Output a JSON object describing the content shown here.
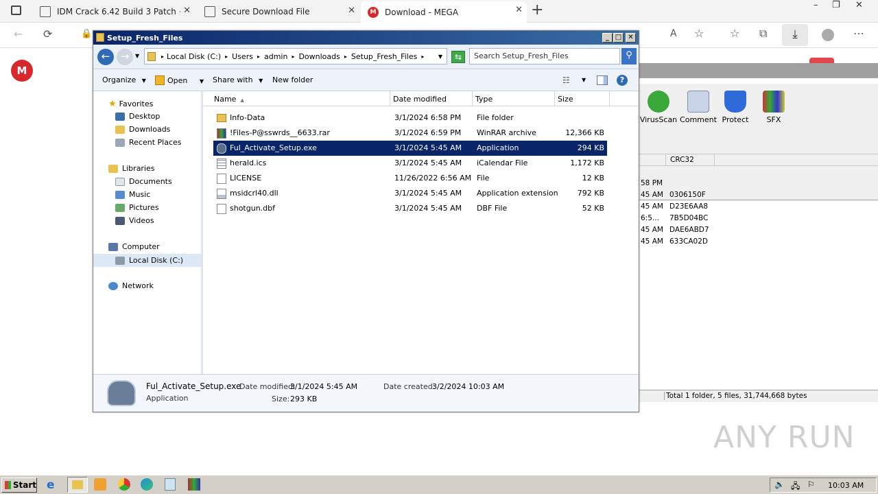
{
  "browser": {
    "tabs": [
      {
        "label": "IDM Crack 6.42 Build 3 Patch + S",
        "active": false
      },
      {
        "label": "Secure Download File",
        "active": false
      },
      {
        "label": "Download - MEGA",
        "active": true
      }
    ],
    "new_tab": "+",
    "window_controls": [
      "–",
      "❐",
      "✕"
    ],
    "read_aloud": "A",
    "mega_logo": "M"
  },
  "winrar": {
    "toolbar": [
      "VirusScan",
      "Comment",
      "Protect",
      "SFX"
    ],
    "column_crc": "CRC32",
    "rows": [
      {
        "time": "58 PM",
        "crc": ""
      },
      {
        "time": "45 AM",
        "crc": "0306150F"
      },
      {
        "time": "45 AM",
        "crc": "D23E6AA8"
      },
      {
        "time": "6:5...",
        "crc": "7B5D04BC"
      },
      {
        "time": "45 AM",
        "crc": "DAE6ABD7"
      },
      {
        "time": "45 AM",
        "crc": "633CA02D"
      }
    ],
    "status": "Total 1 folder, 5 files, 31,744,668 bytes"
  },
  "explorer": {
    "title": "Setup_Fresh_Files",
    "breadcrumb": [
      "Local Disk (C:)",
      "Users",
      "admin",
      "Downloads",
      "Setup_Fresh_Files"
    ],
    "search_placeholder": "Search Setup_Fresh_Files",
    "commands": {
      "organize": "Organize",
      "open": "Open",
      "share": "Share with",
      "new_folder": "New folder"
    },
    "nav": {
      "favorites": "Favorites",
      "desktop": "Desktop",
      "downloads": "Downloads",
      "recent": "Recent Places",
      "libraries": "Libraries",
      "documents": "Documents",
      "music": "Music",
      "pictures": "Pictures",
      "videos": "Videos",
      "computer": "Computer",
      "local_disk": "Local Disk (C:)",
      "network": "Network"
    },
    "columns": {
      "name": "Name",
      "date": "Date modified",
      "type": "Type",
      "size": "Size"
    },
    "files": [
      {
        "name": "Info-Data",
        "date": "3/1/2024 6:58 PM",
        "type": "File folder",
        "size": "",
        "icon": "folder-icon"
      },
      {
        "name": "!Files-P@sswrds__6633.rar",
        "date": "3/1/2024 6:59 PM",
        "type": "WinRAR archive",
        "size": "12,366 KB",
        "icon": "rar-icon"
      },
      {
        "name": "Ful_Activate_Setup.exe",
        "date": "3/1/2024 5:45 AM",
        "type": "Application",
        "size": "294 KB",
        "icon": "phone-icon"
      },
      {
        "name": "herald.ics",
        "date": "3/1/2024 5:45 AM",
        "type": "iCalendar File",
        "size": "1,172 KB",
        "icon": "calendar-icon"
      },
      {
        "name": "LICENSE",
        "date": "11/26/2022 6:56 AM",
        "type": "File",
        "size": "12 KB",
        "icon": "file-icon"
      },
      {
        "name": "msidcrl40.dll",
        "date": "3/1/2024 5:45 AM",
        "type": "Application extension",
        "size": "792 KB",
        "icon": "dll-icon"
      },
      {
        "name": "shotgun.dbf",
        "date": "3/1/2024 5:45 AM",
        "type": "DBF File",
        "size": "52 KB",
        "icon": "file-icon"
      }
    ],
    "details": {
      "name": "Ful_Activate_Setup.exe",
      "type": "Application",
      "modified_label": "Date modified:",
      "modified": "3/1/2024 5:45 AM",
      "created_label": "Date created:",
      "created": "3/2/2024 10:03 AM",
      "size_label": "Size:",
      "size": "293 KB"
    }
  },
  "watermark": "ANY RUN",
  "taskbar": {
    "start": "Start",
    "clock": "10:03 AM"
  }
}
